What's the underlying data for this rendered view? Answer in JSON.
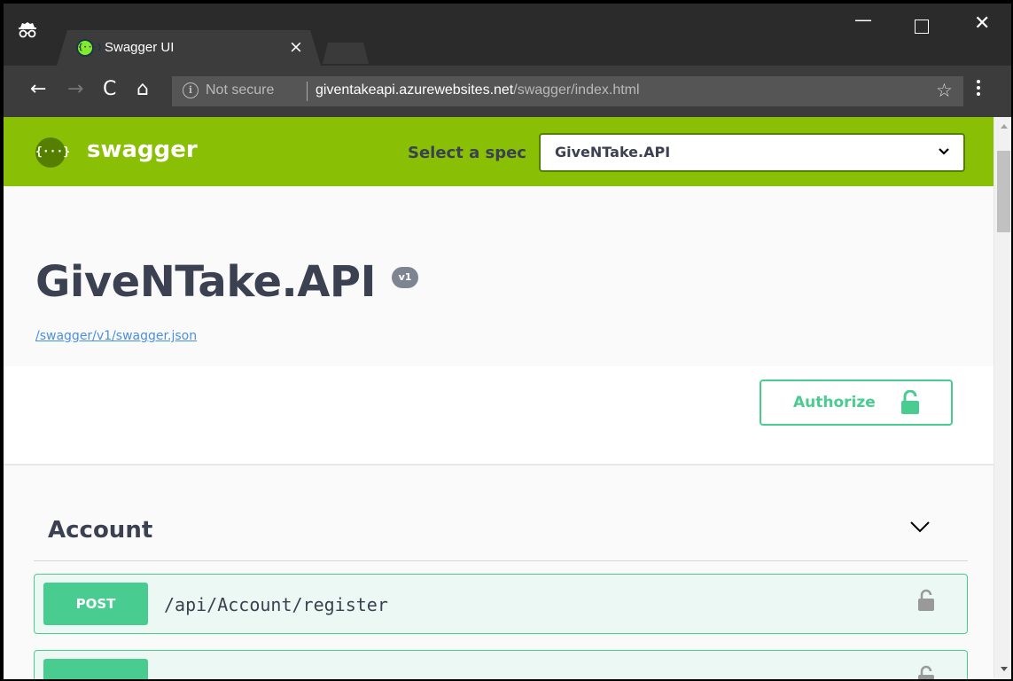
{
  "browser": {
    "tab_title": "Swagger UI",
    "tab_close": "×",
    "tab_favicon": "{···}",
    "address": {
      "security_label": "Not secure",
      "url_host": "giventakeapi.azurewebsites.net",
      "url_path": "/swagger/index.html"
    },
    "icons": [
      "incognito-icon",
      "back-icon",
      "forward-icon",
      "reload-icon",
      "home-icon",
      "info-icon",
      "star-icon",
      "menu-icon"
    ],
    "nav_glyphs": {
      "back": "←",
      "forward": "→",
      "reload": "C",
      "home": "⌂",
      "star": "☆",
      "info": "i",
      "close": "✕",
      "minimize": "—"
    }
  },
  "swagger": {
    "brand": "swagger",
    "logo_glyph": "{···}",
    "spec_select_label": "Select a spec",
    "spec_selected": "GiveNTake.API",
    "title": "GiveNTake.API",
    "version": "v1",
    "spec_link": "/swagger/v1/swagger.json",
    "authorize_label": "Authorize",
    "colors": {
      "topbar": "#89bf04",
      "post": "#49cc90",
      "text": "#3b4151",
      "link": "#4990e2"
    }
  },
  "operations": {
    "tag": "Account",
    "items": [
      {
        "method": "POST",
        "path": "/api/Account/register"
      },
      {
        "method": "",
        "path": ""
      }
    ]
  }
}
